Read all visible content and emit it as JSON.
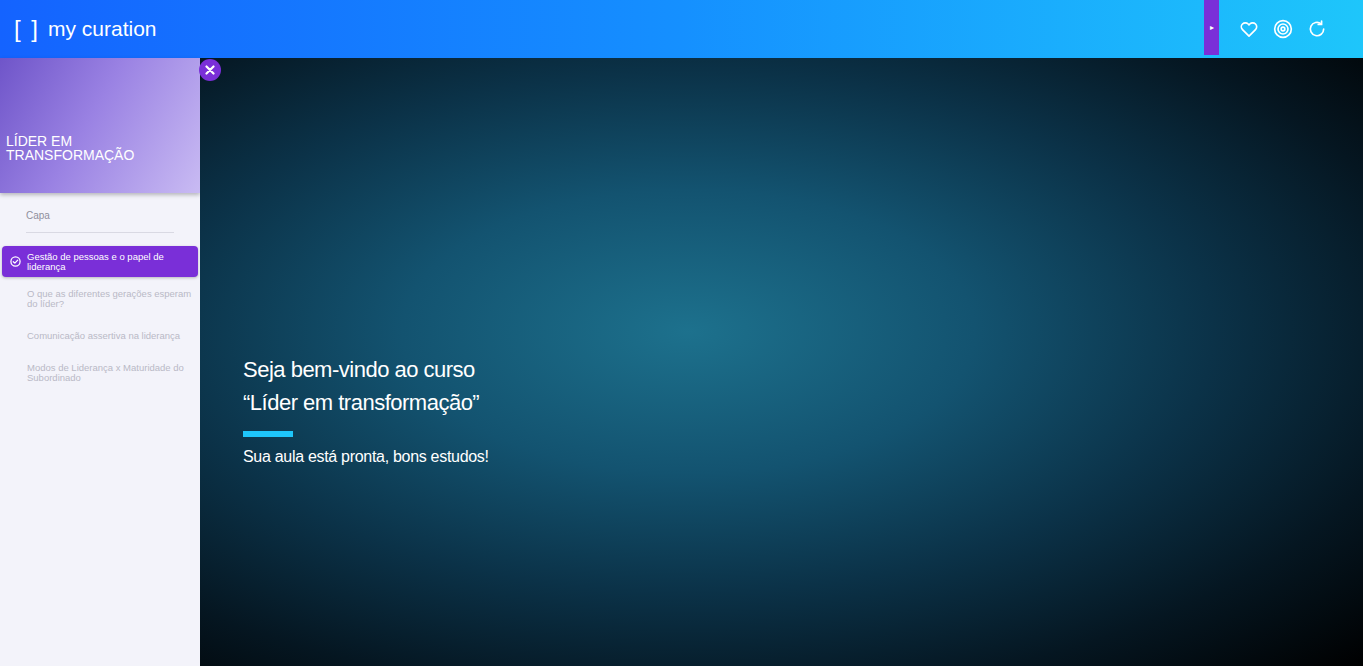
{
  "header": {
    "logo_bracket": "[ ]",
    "logo_text": "my curation",
    "panel_toggle": "▸"
  },
  "course": {
    "title": "LÍDER EM TRANSFORMAÇÃO"
  },
  "sidebar": {
    "items": [
      {
        "label": "Capa",
        "kind": "cover",
        "selected": false,
        "completed": false
      },
      {
        "label": "Gestão de pessoas e o papel de liderança",
        "kind": "lesson",
        "selected": true,
        "completed": true
      },
      {
        "label": "O que as diferentes gerações esperam do líder?",
        "kind": "lesson",
        "selected": false,
        "completed": false
      },
      {
        "label": "Comunicação assertiva na liderança",
        "kind": "lesson",
        "selected": false,
        "completed": false
      },
      {
        "label": "Modos de Liderança x Maturidade do Subordinado",
        "kind": "lesson",
        "selected": false,
        "completed": false
      }
    ]
  },
  "slide": {
    "title_lines": [
      "Seja bem-vindo ao curso",
      "“Líder em transformação”"
    ],
    "subtitle": "Sua aula está pronta, bons estudos!"
  }
}
